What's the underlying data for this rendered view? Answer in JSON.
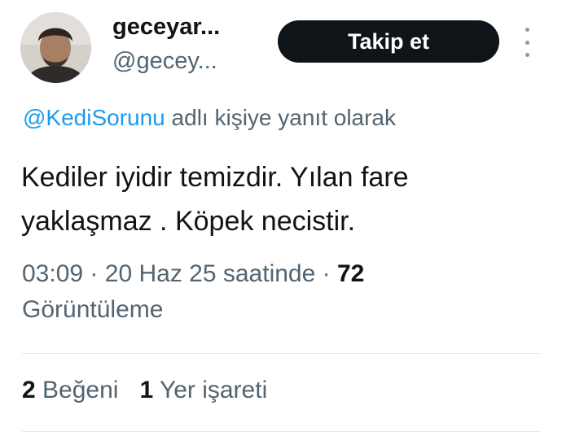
{
  "author": {
    "display_name": "geceyar...",
    "handle": "@gecey..."
  },
  "actions": {
    "follow_label": "Takip et",
    "more_icon": "more-vertical-icon"
  },
  "reply_context": {
    "mention": "@KediSorunu",
    "suffix": "adlı kişiye yanıt olarak"
  },
  "tweet": {
    "text_line1": "Kediler iyidir temizdir. Yılan fare",
    "text_line2": "yaklaşmaz . Köpek necistir."
  },
  "meta": {
    "time": "03:09",
    "sep1": "·",
    "date": "20 Haz 25 saatinde",
    "sep2": "·",
    "views_count": "72",
    "views_label": "Görüntüleme"
  },
  "stats": {
    "likes_count": "2",
    "likes_label": "Beğeni",
    "bookmarks_count": "1",
    "bookmarks_label": "Yer işareti"
  },
  "colors": {
    "link": "#1d9bf0",
    "secondary_text": "#536471",
    "primary_text": "#0f1419",
    "button_bg": "#0f1419"
  }
}
